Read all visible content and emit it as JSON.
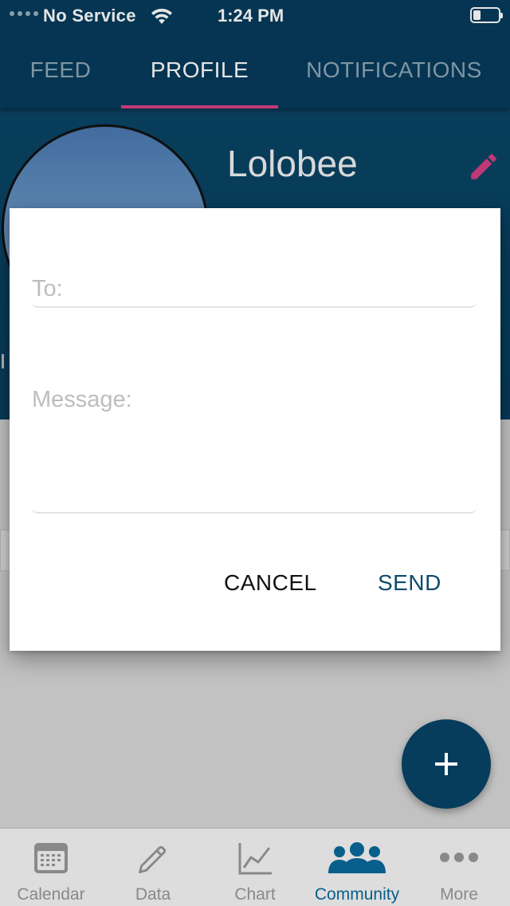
{
  "status_bar": {
    "carrier": "No Service",
    "time": "1:24 PM"
  },
  "tabs": [
    {
      "label": "FEED",
      "active": false
    },
    {
      "label": "PROFILE",
      "active": true
    },
    {
      "label": "NOTIFICATIONS",
      "active": false
    }
  ],
  "profile": {
    "username": "Lolobee"
  },
  "dialog": {
    "to_placeholder": "To:",
    "to_value": "",
    "message_placeholder": "Message:",
    "message_value": "",
    "cancel_label": "CANCEL",
    "send_label": "SEND"
  },
  "fab": {
    "icon": "plus-icon"
  },
  "bottom_nav": [
    {
      "label": "Calendar",
      "icon": "calendar-icon",
      "active": false
    },
    {
      "label": "Data",
      "icon": "pencil-icon",
      "active": false
    },
    {
      "label": "Chart",
      "icon": "line-chart-icon",
      "active": false
    },
    {
      "label": "Community",
      "icon": "people-icon",
      "active": true
    },
    {
      "label": "More",
      "icon": "more-dots-icon",
      "active": false
    }
  ],
  "colors": {
    "header": "#063c5c",
    "accent_pink": "#d64085",
    "active_nav": "#0b6a9b"
  }
}
